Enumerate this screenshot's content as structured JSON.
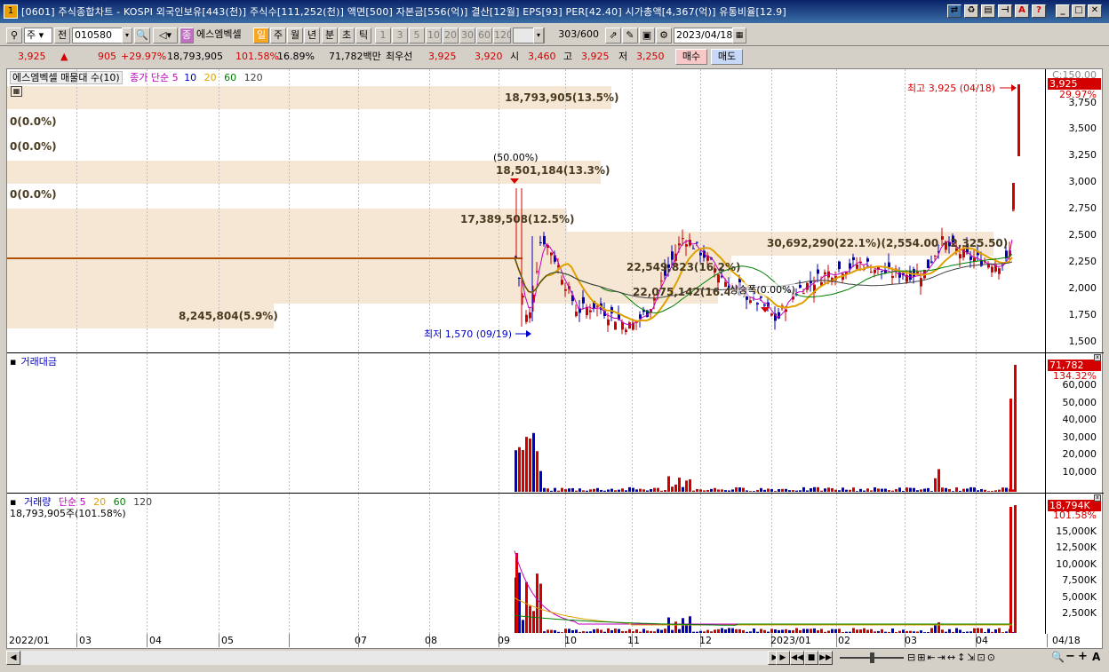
{
  "window": {
    "title": "[0601] 주식종합차트 - KOSPI 외국인보유[443(천)] 주식수[111,252(천)] 액면[500] 자본금[556(억)] 결산[12월] EPS[93] PER[42.40] 시가총액[4,367(억)] 유통비율[12.9]",
    "app_icon": "1"
  },
  "toolbar": {
    "market_select": "주",
    "prev_label": "전",
    "stock_code": "010580",
    "stock_name": "에스엠벡셀",
    "period_tabs": [
      "일",
      "주",
      "월",
      "년",
      "분",
      "초",
      "틱"
    ],
    "active_period": "일",
    "interval_buttons": [
      "1",
      "3",
      "5",
      "10",
      "20",
      "30",
      "60",
      "120"
    ],
    "count_value": "303",
    "count_total": "/600",
    "date_value": "2023/04/18"
  },
  "quote": {
    "price": "3,925",
    "change": "905",
    "change_pct": "+29.97%",
    "volume": "18,793,905",
    "volume_ratio": "101.58%",
    "turnover_pct": "16.89%",
    "amount": "71,782백만",
    "best_label": "최우선",
    "ask": "3,925",
    "bid": "3,920",
    "open_label": "시",
    "open": "3,460",
    "high_label": "고",
    "high": "3,925",
    "low_label": "저",
    "low": "3,250",
    "buy_label": "매수",
    "sell_label": "매도"
  },
  "price_pane": {
    "profile_legend": "에스엠벡셀 매물대 수(10)",
    "ma_legend": [
      "종가 단순 5",
      "10",
      "20",
      "60",
      "120"
    ],
    "ma_colors": [
      "#c000c0",
      "#0000c0",
      "#e0a000",
      "#008000",
      "#404040"
    ],
    "axis_top_label": "C:150.00",
    "current_badge": "3,925",
    "current_pct": "29.97%",
    "high_marker": "최고 3,925 (04/18)",
    "low_marker": "최저 1,570 (09/19)",
    "peak_marker": "(50.00%)",
    "limit_up_marker": "상승폭(0.00%)",
    "y_ticks": [
      "3,750",
      "3,500",
      "3,250",
      "3,000",
      "2,750",
      "2,500",
      "2,250",
      "2,000",
      "1,750",
      "1,500"
    ],
    "profile_labels": [
      "18,793,905(13.5%)",
      "0(0.0%)",
      "0(0.0%)",
      "18,501,184(13.3%)",
      "0(0.0%)",
      "17,389,508(12.5%)",
      "30,692,290(22.1%)(2,554.00 - 2,325.50)",
      "22,549,823(16.2%)",
      "22,075,142(16.4%)",
      "8,245,804(5.9%)"
    ]
  },
  "amount_pane": {
    "legend": "거래대금",
    "current_badge": "71,782",
    "current_pct": "134.32%",
    "y_ticks": [
      "60,000",
      "50,000",
      "40,000",
      "30,000",
      "20,000",
      "10,000"
    ]
  },
  "volume_pane": {
    "legend": [
      "거래량",
      "단순 5",
      "20",
      "60",
      "120"
    ],
    "legend_colors": [
      "#0000c0",
      "#c000c0",
      "#e0a000",
      "#008000",
      "#404040"
    ],
    "value_line": "18,793,905주(101.58%)",
    "current_badge": "18,794K",
    "current_pct": "101.58%",
    "y_ticks": [
      "15,000K",
      "12,500K",
      "10,000K",
      "7,500K",
      "5,000K",
      "2,500K"
    ]
  },
  "x_axis": {
    "labels": [
      "2022/01",
      "03",
      "04",
      "05",
      "07",
      "08",
      "09",
      "10",
      "11",
      "12",
      "2023/01",
      "02",
      "03",
      "04"
    ],
    "current_label": "04/18"
  },
  "chart_data": {
    "type": "candlestick",
    "title": "",
    "ylim": [
      1500,
      3900
    ],
    "high": 3925,
    "low": 1570,
    "last": 3925,
    "volume_last": 18793905,
    "amount_last_million": 71782
  },
  "colors": {
    "up": "#d40000",
    "down": "#0000c8",
    "band": "#f5e7d3",
    "title_bar": "#0a246a"
  }
}
